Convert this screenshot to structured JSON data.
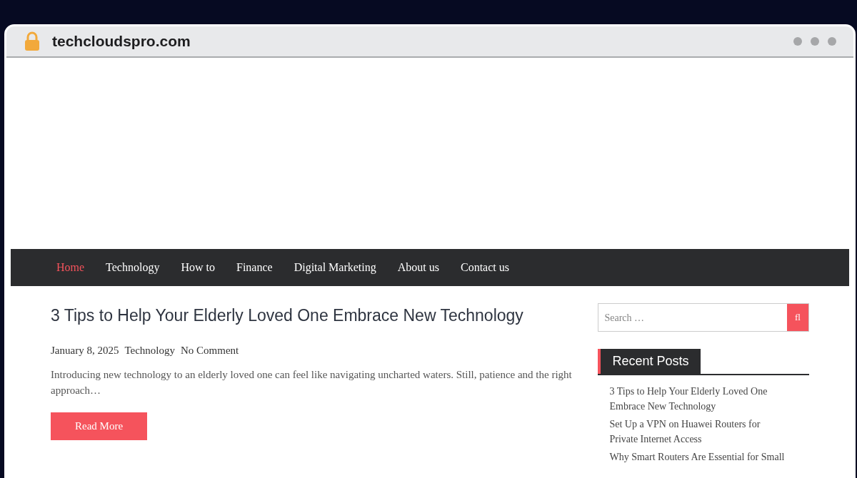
{
  "browser": {
    "address": "techcloudspro.com"
  },
  "nav": [
    {
      "label": "Home",
      "selected": true
    },
    {
      "label": "Technology",
      "selected": false
    },
    {
      "label": "How to",
      "selected": false
    },
    {
      "label": "Finance",
      "selected": false
    },
    {
      "label": "Digital Marketing",
      "selected": false
    },
    {
      "label": "About us",
      "selected": false
    },
    {
      "label": "Contact us",
      "selected": false
    }
  ],
  "post": {
    "title": "3 Tips to Help Your Elderly Loved One Embrace New Technology",
    "date": "January 8, 2025",
    "category": "Technology",
    "comments": "No Comment",
    "excerpt": "Introducing new technology to an elderly loved one can feel like navigating uncharted waters. Still, patience and the right approach…",
    "button": "Read More"
  },
  "sidebar": {
    "search": {
      "placeholder": "Search …",
      "button": "fl"
    },
    "recent_title": "Recent Posts",
    "recent_posts": [
      "3 Tips to Help Your Elderly Loved One Embrace New Technology",
      "Set Up a VPN on Huawei Routers for Private Internet Access",
      "Why Smart Routers Are Essential for Small"
    ]
  }
}
